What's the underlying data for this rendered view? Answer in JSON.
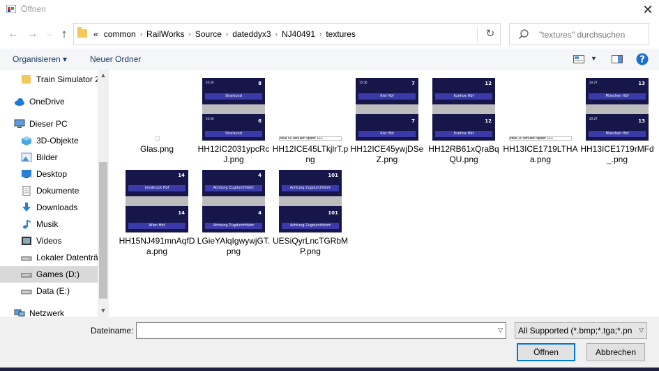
{
  "window": {
    "title": "Öffnen"
  },
  "nav": {
    "breadcrumbs": [
      "«",
      "common",
      "RailWorks",
      "Source",
      "dateddyx3",
      "NJ40491",
      "textures"
    ],
    "search_placeholder": "\"textures\" durchsuchen"
  },
  "toolbar": {
    "organize_label": "Organisieren ▾",
    "new_folder_label": "Neuer Ordner"
  },
  "sidebar": {
    "items": [
      {
        "label": "Train Simulator 2",
        "icon": "folder-icon"
      },
      {
        "label": "OneDrive",
        "icon": "cloud-icon"
      },
      {
        "label": "Dieser PC",
        "icon": "computer-icon"
      },
      {
        "label": "3D-Objekte",
        "icon": "cube-icon"
      },
      {
        "label": "Bilder",
        "icon": "pictures-icon"
      },
      {
        "label": "Desktop",
        "icon": "desktop-icon"
      },
      {
        "label": "Dokumente",
        "icon": "documents-icon"
      },
      {
        "label": "Downloads",
        "icon": "download-icon"
      },
      {
        "label": "Musik",
        "icon": "music-icon"
      },
      {
        "label": "Videos",
        "icon": "video-icon"
      },
      {
        "label": "Lokaler Datenträ",
        "icon": "drive-icon"
      },
      {
        "label": "Games (D:)",
        "icon": "drive-icon"
      },
      {
        "label": "Data (E:)",
        "icon": "drive-icon"
      },
      {
        "label": "Netzwerk",
        "icon": "network-icon"
      }
    ],
    "selected": "Games (D:)"
  },
  "files": [
    {
      "name": "Glas.png",
      "kind": "blank"
    },
    {
      "name": "HH12IC2031ypcRcJ.png",
      "kind": "panel",
      "top_num": "8",
      "bot_num": "6",
      "top_text": "Stralsund",
      "bot_text": "Stralsund",
      "top_time": "20:20",
      "bot_time": "20:20"
    },
    {
      "name": "HH12ICE45LTkjlrT.png",
      "kind": "strip",
      "strip_text": "etwa 50 Minuten später   +++"
    },
    {
      "name": "HH12ICE45ywjDSeZ.png",
      "kind": "panel",
      "top_num": "7",
      "bot_num": "7",
      "top_text": "Kiel Hbf",
      "bot_text": "Kiel Hbf",
      "top_time": "15:30",
      "bot_time": ""
    },
    {
      "name": "HH12RB61xQraBqQU.png",
      "kind": "panel",
      "top_num": "12",
      "bot_num": "12",
      "top_text": "Itzehoe Hbf",
      "bot_text": "Itzehoe Hbf",
      "top_time": "",
      "bot_time": ""
    },
    {
      "name": "HH13ICE1719LTHAa.png",
      "kind": "strip",
      "strip_text": "etwa 20 Minuten später   +++"
    },
    {
      "name": "HH13ICE1719rMFd_.png",
      "kind": "panel",
      "top_num": "13",
      "bot_num": "13",
      "top_text": "München Hbf",
      "bot_text": "München Hbf",
      "top_time": "20:27",
      "bot_time": "20:27"
    },
    {
      "name": "HH15NJ491mnAqfDa.png",
      "kind": "panel",
      "top_num": "14",
      "bot_num": "14",
      "top_text": "Innsbruck Hbf",
      "bot_text": "Wien Hbf",
      "top_time": "",
      "bot_time": ""
    },
    {
      "name": "LGieYAlqIgwywjGT.png",
      "kind": "panel",
      "top_num": "4",
      "bot_num": "4",
      "top_text": "Achtung Zugdurchfahrt",
      "bot_text": "Achtung Zugdurchfahrt",
      "top_time": "",
      "bot_time": ""
    },
    {
      "name": "UESiQyrLncTGRbMP.png",
      "kind": "panel",
      "top_num": "101",
      "bot_num": "101",
      "top_text": "Achtung Zugdurchfahrt",
      "bot_text": "Achtung Zugdurchfahrt",
      "top_time": "",
      "bot_time": ""
    }
  ],
  "bottom": {
    "filename_label": "Dateiname:",
    "filename_value": "",
    "filter_value": "All Supported (*.bmp;*.tga;*.pn",
    "open_label": "Öffnen",
    "cancel_label": "Abbrechen"
  },
  "colors": {
    "accent": "#0078d7",
    "selected_bg": "#d9d9d9",
    "panel_blue": "#16164a",
    "bar_blue": "#3a3aa8"
  }
}
